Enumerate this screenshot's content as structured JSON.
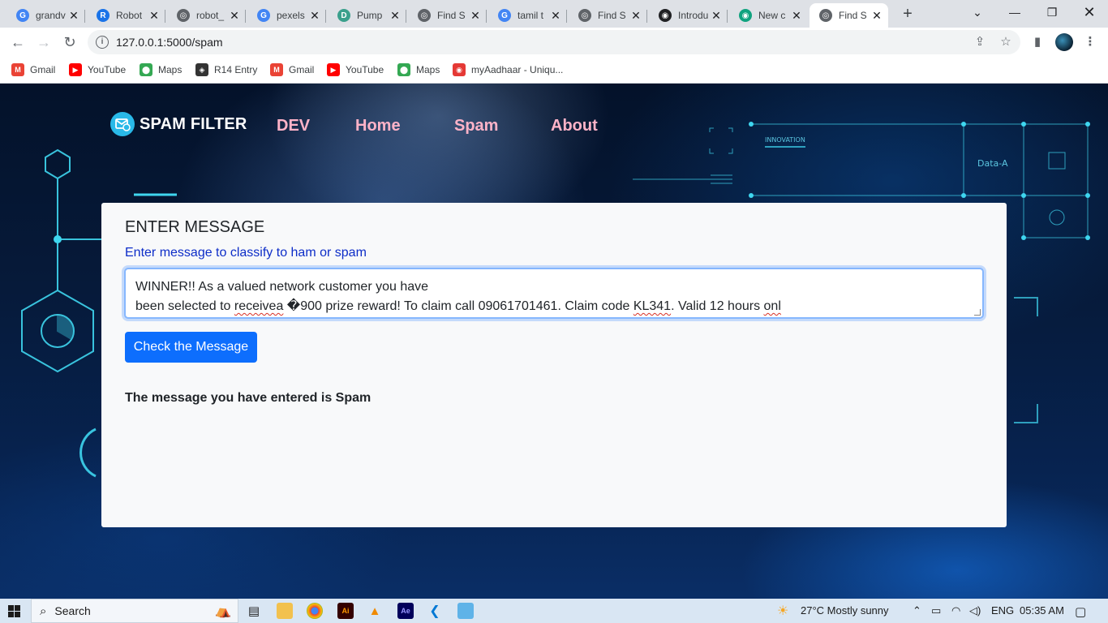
{
  "browser": {
    "tabs": [
      {
        "title": "grandv",
        "favicon": "G",
        "favicon_color": "#4285f4"
      },
      {
        "title": "Robot",
        "favicon": "R",
        "favicon_color": "#1a73e8"
      },
      {
        "title": "robot_",
        "favicon": "◎",
        "favicon_color": "#5f6368"
      },
      {
        "title": "pexels",
        "favicon": "G",
        "favicon_color": "#4285f4"
      },
      {
        "title": "Pump",
        "favicon": "D",
        "favicon_color": "#3aa08c"
      },
      {
        "title": "Find S",
        "favicon": "◎",
        "favicon_color": "#5f6368"
      },
      {
        "title": "tamil t",
        "favicon": "G",
        "favicon_color": "#4285f4"
      },
      {
        "title": "Find S",
        "favicon": "◎",
        "favicon_color": "#5f6368"
      },
      {
        "title": "Introdu",
        "favicon": "◉",
        "favicon_color": "#202124"
      },
      {
        "title": "New c",
        "favicon": "◉",
        "favicon_color": "#10a37f"
      },
      {
        "title": "Find S",
        "favicon": "◎",
        "favicon_color": "#5f6368"
      }
    ],
    "active_tab_index": 10,
    "url": "127.0.0.1:5000/spam",
    "bookmarks": [
      {
        "label": "Gmail",
        "icon": "M",
        "color": "#ea4335"
      },
      {
        "label": "YouTube",
        "icon": "▶",
        "color": "#ff0000"
      },
      {
        "label": "Maps",
        "icon": "⬤",
        "color": "#34a853"
      },
      {
        "label": "R14 Entry",
        "icon": "◈",
        "color": "#333333"
      },
      {
        "label": "Gmail",
        "icon": "M",
        "color": "#ea4335"
      },
      {
        "label": "YouTube",
        "icon": "▶",
        "color": "#ff0000"
      },
      {
        "label": "Maps",
        "icon": "⬤",
        "color": "#34a853"
      },
      {
        "label": "myAadhaar - Uniqu...",
        "icon": "◉",
        "color": "#e53935"
      }
    ]
  },
  "site": {
    "brand": "SPAM FILTER",
    "nav": [
      "DEV",
      "Home",
      "Spam",
      "About"
    ],
    "hud_labels": {
      "tag": "INNOVATION",
      "data": "Data-A"
    }
  },
  "form": {
    "title": "ENTER MESSAGE",
    "subtitle": "Enter message to classify to ham or spam",
    "message_line1": "WINNER!! As a valued network customer you have",
    "message_line2_a": "been selected to ",
    "message_line2_b": "receivea",
    "message_line2_c": " �900 prize reward! To claim call 09061701461. Claim code ",
    "message_line2_d": "KL341",
    "message_line2_e": ". Valid 12 hours ",
    "message_line2_f": "onl",
    "button": "Check the Message",
    "result": "The message you have entered is Spam"
  },
  "taskbar": {
    "search": "Search",
    "weather": "27°C  Mostly sunny",
    "lang": "ENG",
    "time": "05:35 AM"
  }
}
